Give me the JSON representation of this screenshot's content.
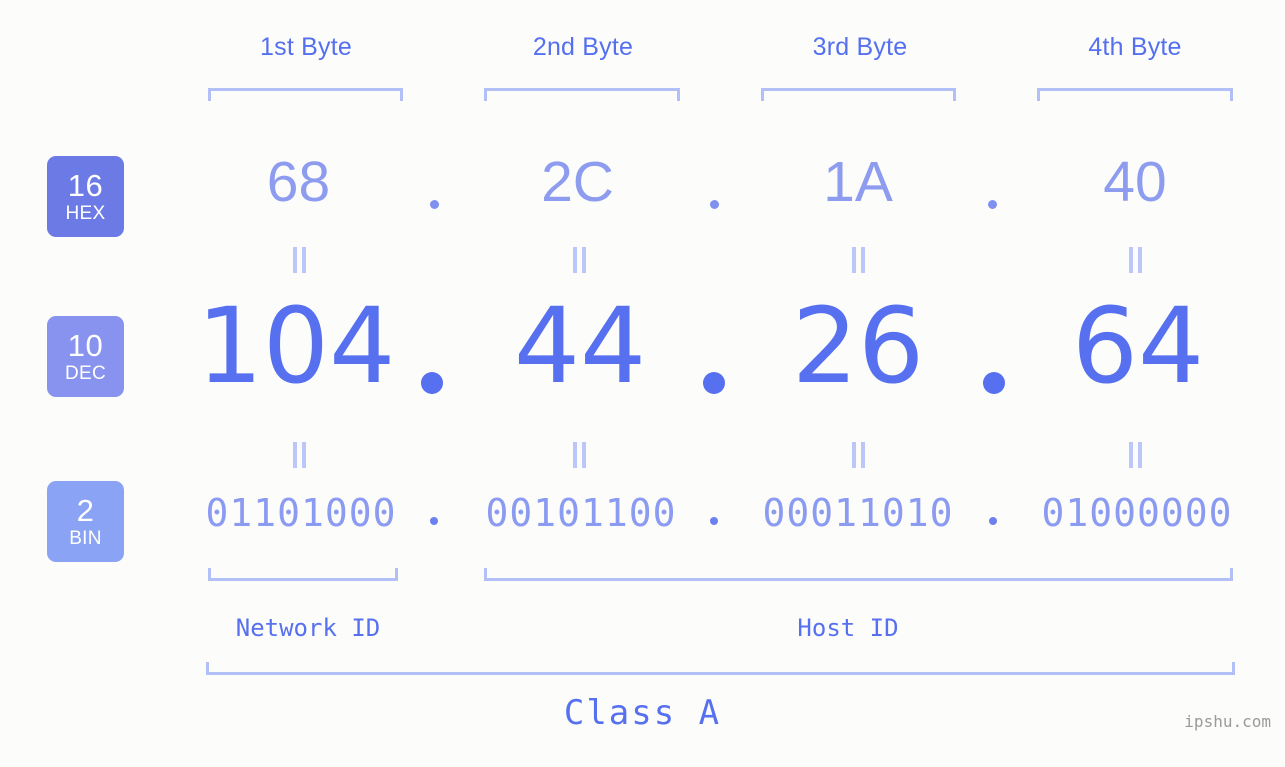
{
  "meta": {
    "background_color": "#fcfdfa",
    "accent_color": "#5770ef",
    "light_accent_color": "#b3c0f7",
    "watermark": "ipshu.com"
  },
  "byte_headers": [
    {
      "label": "1st Byte"
    },
    {
      "label": "2nd Byte"
    },
    {
      "label": "3rd Byte"
    },
    {
      "label": "4th Byte"
    }
  ],
  "rows": {
    "hex": {
      "badge_number": "16",
      "badge_name": "HEX",
      "badge_color": "#6c7ae6",
      "values": [
        "68",
        "2C",
        "1A",
        "40"
      ],
      "separator": "."
    },
    "dec": {
      "badge_number": "10",
      "badge_name": "DEC",
      "badge_color": "#8793ee",
      "values": [
        "104",
        "44",
        "26",
        "64"
      ],
      "separator": "."
    },
    "bin": {
      "badge_number": "2",
      "badge_name": "BIN",
      "badge_color": "#8ba3f4",
      "values": [
        "01101000",
        "00101100",
        "00011010",
        "01000000"
      ],
      "separator": "."
    }
  },
  "equals_glyph": "||",
  "id_sections": [
    {
      "label": "Network ID"
    },
    {
      "label": "Host ID"
    }
  ],
  "class_label": "Class A"
}
